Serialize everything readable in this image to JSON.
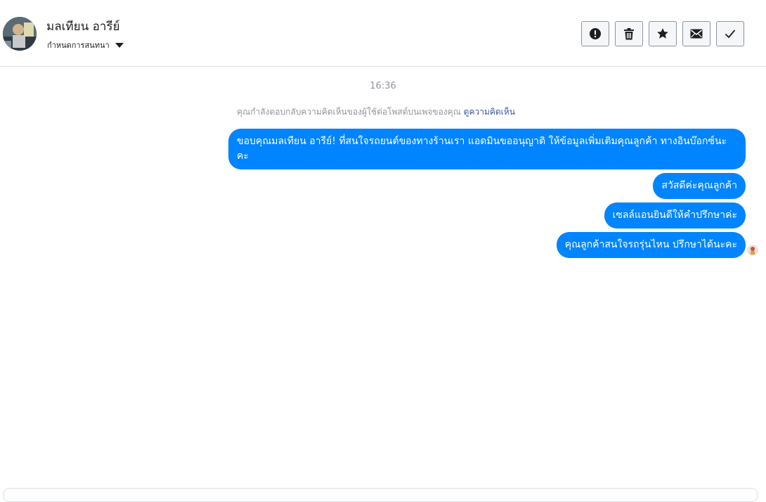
{
  "header": {
    "contact_name": "มลเทียน อารีย์",
    "label_select": "กำหนดการสนทนา",
    "actions": [
      {
        "name": "report",
        "icon": "exclamation-icon"
      },
      {
        "name": "delete",
        "icon": "trash-icon"
      },
      {
        "name": "star",
        "icon": "star-icon"
      },
      {
        "name": "mark-unread",
        "icon": "envelope-icon"
      },
      {
        "name": "mark-done",
        "icon": "check-icon"
      }
    ]
  },
  "thread": {
    "timestamp": "16:36",
    "context_note": "คุณกำลังตอบกลับความคิดเห็นของผู้ใช้ต่อโพสต์บนเพจของคุณ",
    "context_link": "ดูความคิดเห็น",
    "messages": [
      {
        "text": "ขอบคุณมลเทียน อารีย์! ที่สนใจรถยนต์ของทางร้านเรา แอดมินขออนุญาติ ให้ข้อมูลเพิ่มเติมคุณลูกค้า ทางอินบ๊อกซ์นะคะ"
      },
      {
        "text": "สวัสดีค่ะคุณลูกค้า"
      },
      {
        "text": "เซลล์แอนยินดีให้คำปรึกษาค่ะ"
      },
      {
        "text": "คุณลูกค้าสนใจรถรุ่นไหน ปรึกษาได้นะคะ"
      }
    ]
  },
  "colors": {
    "bubble": "#0084ff",
    "link": "#385898",
    "muted_text": "#90949c"
  }
}
